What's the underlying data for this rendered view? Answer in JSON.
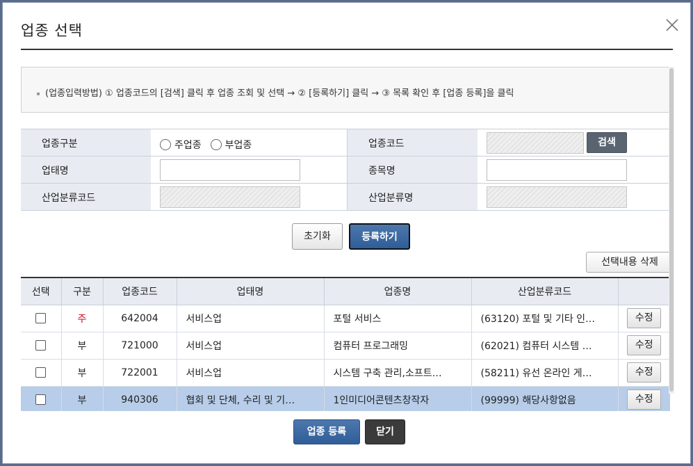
{
  "dialog": {
    "title": "업종 선택",
    "close_icon": "close-icon"
  },
  "notice": {
    "text": "(업종입력방법) ① 업종코드의 [검색] 클릭 후 업종 조회 및 선택 → ② [등록하기] 클릭 → ③ 목록 확인 후 [업종 등록]을 클릭"
  },
  "form": {
    "type_label": "업종구분",
    "type_options": [
      "주업종",
      "부업종"
    ],
    "code_label": "업종코드",
    "code_value": "",
    "search_label": "검색",
    "business_label": "업태명",
    "business_value": "",
    "item_label": "종목명",
    "item_value": "",
    "industry_code_label": "산업분류코드",
    "industry_code_value": "",
    "industry_name_label": "산업분류명",
    "industry_name_value": ""
  },
  "actions": {
    "reset_label": "초기화",
    "register_label": "등록하기",
    "delete_selected_label": "선택내용 삭제"
  },
  "grid": {
    "headers": [
      "선택",
      "구분",
      "업종코드",
      "업태명",
      "업종명",
      "산업분류코드",
      ""
    ],
    "edit_label": "수정",
    "rows": [
      {
        "type": "주",
        "code": "642004",
        "business": "서비스업",
        "name": "포털 서비스",
        "industry": "(63120) 포털 및 기타 인…"
      },
      {
        "type": "부",
        "code": "721000",
        "business": "서비스업",
        "name": "컴퓨터 프로그래밍",
        "industry": "(62021) 컴퓨터 시스템 …"
      },
      {
        "type": "부",
        "code": "722001",
        "business": "서비스업",
        "name": "시스템 구축 관리,소프트…",
        "industry": "(58211) 유선 온라인 게…"
      },
      {
        "type": "부",
        "code": "940306",
        "business": "협회 및 단체, 수리 및 기…",
        "name": "1인미디어콘텐츠창작자",
        "industry": "(99999) 해당사항없음"
      }
    ]
  },
  "footer": {
    "register_label": "업종 등록",
    "close_label": "닫기"
  },
  "colors": {
    "primary": "#2f5d98",
    "header_bg": "#e8ecf2",
    "selected_row": "#b7cde9",
    "main_type": "#d0021b"
  }
}
